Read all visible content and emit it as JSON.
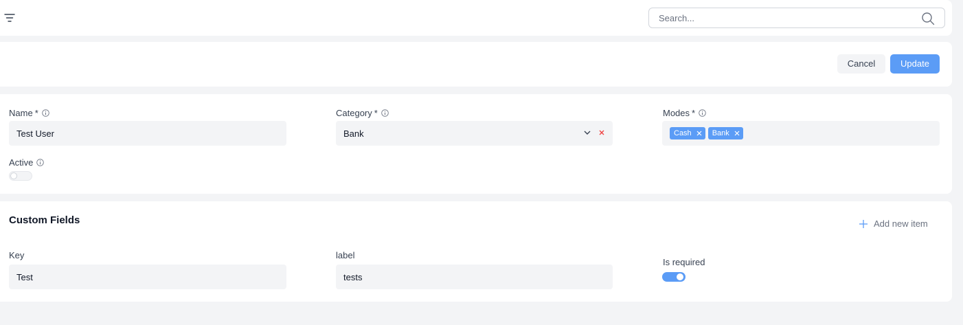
{
  "topbar": {
    "search_placeholder": "Search..."
  },
  "actions": {
    "cancel_label": "Cancel",
    "update_label": "Update"
  },
  "form": {
    "name": {
      "label": "Name",
      "required_mark": "*",
      "value": "Test User"
    },
    "category": {
      "label": "Category",
      "required_mark": "*",
      "value": "Bank"
    },
    "modes": {
      "label": "Modes",
      "required_mark": "*",
      "tags": [
        "Cash",
        "Bank"
      ]
    },
    "active": {
      "label": "Active",
      "value": false
    }
  },
  "custom_fields": {
    "title": "Custom Fields",
    "add_label": "Add new item",
    "key": {
      "label": "Key",
      "value": "Test"
    },
    "field_label": {
      "label": "label",
      "value": "tests"
    },
    "is_required": {
      "label": "Is required",
      "value": true
    }
  },
  "colors": {
    "accent": "#5b9cf6",
    "clear": "#ef4444"
  }
}
